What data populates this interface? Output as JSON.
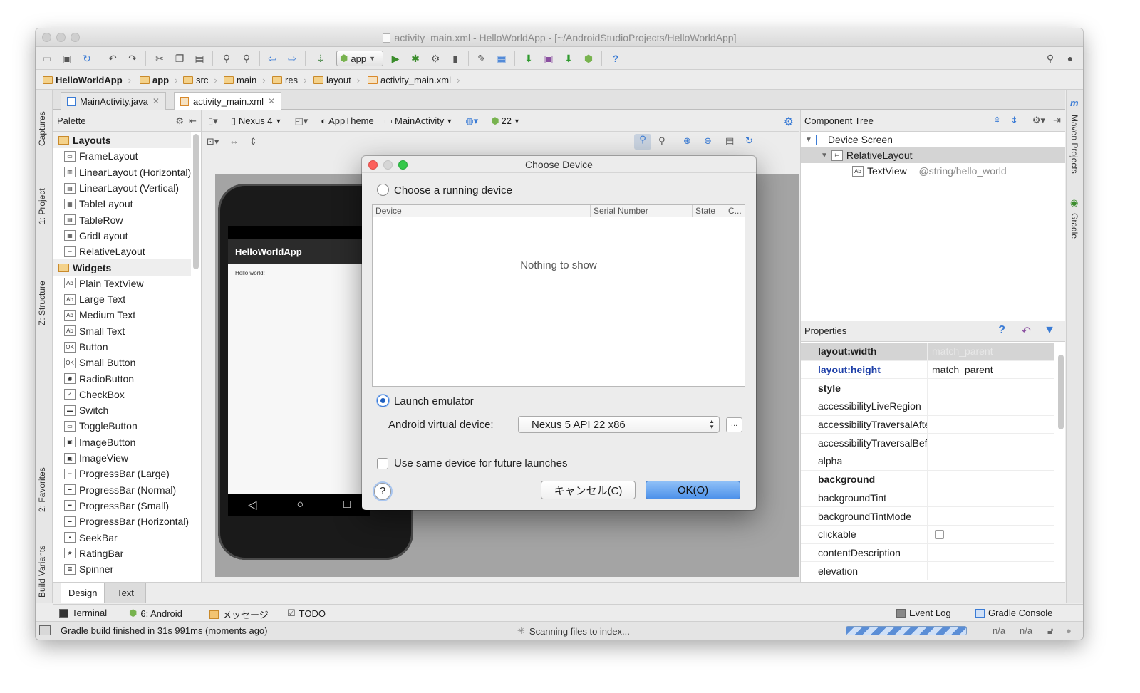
{
  "window": {
    "title": "activity_main.xml - HelloWorldApp - [~/AndroidStudioProjects/HelloWorldApp]"
  },
  "toolbar": {
    "run_config": "app"
  },
  "breadcrumb": [
    "HelloWorldApp",
    "app",
    "src",
    "main",
    "res",
    "layout",
    "activity_main.xml"
  ],
  "editor_tabs": [
    {
      "label": "MainActivity.java",
      "active": false
    },
    {
      "label": "activity_main.xml",
      "active": true
    }
  ],
  "left_tool_tabs": [
    "Captures",
    "1: Project",
    "Z: Structure",
    "2: Favorites",
    "Build Variants"
  ],
  "right_tool_tabs": [
    "Maven Projects",
    "Gradle"
  ],
  "palette": {
    "title": "Palette",
    "items": [
      {
        "label": "Layouts",
        "group": true
      },
      {
        "label": "FrameLayout"
      },
      {
        "label": "LinearLayout (Horizontal)"
      },
      {
        "label": "LinearLayout (Vertical)"
      },
      {
        "label": "TableLayout"
      },
      {
        "label": "TableRow"
      },
      {
        "label": "GridLayout"
      },
      {
        "label": "RelativeLayout"
      },
      {
        "label": "Widgets",
        "group": true
      },
      {
        "label": "Plain TextView"
      },
      {
        "label": "Large Text"
      },
      {
        "label": "Medium Text"
      },
      {
        "label": "Small Text"
      },
      {
        "label": "Button"
      },
      {
        "label": "Small Button"
      },
      {
        "label": "RadioButton"
      },
      {
        "label": "CheckBox"
      },
      {
        "label": "Switch"
      },
      {
        "label": "ToggleButton"
      },
      {
        "label": "ImageButton"
      },
      {
        "label": "ImageView"
      },
      {
        "label": "ProgressBar (Large)"
      },
      {
        "label": "ProgressBar (Normal)"
      },
      {
        "label": "ProgressBar (Small)"
      },
      {
        "label": "ProgressBar (Horizontal)"
      },
      {
        "label": "SeekBar"
      },
      {
        "label": "RatingBar"
      },
      {
        "label": "Spinner"
      }
    ]
  },
  "design_toolbar": {
    "device": "Nexus 4",
    "theme": "AppTheme",
    "activity": "MainActivity",
    "api": "22"
  },
  "preview": {
    "app_title": "HelloWorldApp",
    "body_text": "Hello world!"
  },
  "component_tree": {
    "title": "Component Tree",
    "rows": [
      {
        "label": "Device Screen",
        "sub": ""
      },
      {
        "label": "RelativeLayout",
        "sub": ""
      },
      {
        "label": "TextView",
        "sub": "– @string/hello_world"
      }
    ]
  },
  "properties": {
    "title": "Properties",
    "rows": [
      {
        "name": "layout:width",
        "value": "match_parent"
      },
      {
        "name": "layout:height",
        "value": "match_parent"
      },
      {
        "name": "style",
        "value": ""
      },
      {
        "name": "accessibilityLiveRegion",
        "value": ""
      },
      {
        "name": "accessibilityTraversalAfter",
        "value": ""
      },
      {
        "name": "accessibilityTraversalBefore",
        "value": ""
      },
      {
        "name": "alpha",
        "value": ""
      },
      {
        "name": "background",
        "value": ""
      },
      {
        "name": "backgroundTint",
        "value": ""
      },
      {
        "name": "backgroundTintMode",
        "value": ""
      },
      {
        "name": "clickable",
        "value": ""
      },
      {
        "name": "contentDescription",
        "value": ""
      },
      {
        "name": "elevation",
        "value": ""
      }
    ]
  },
  "bottom_tabs": {
    "design": "Design",
    "text": "Text"
  },
  "tool_windows": {
    "terminal": "Terminal",
    "android": "6: Android",
    "messages": "メッセージ",
    "todo": "TODO",
    "event_log": "Event Log",
    "gradle_console": "Gradle Console"
  },
  "status": {
    "message": "Gradle build finished in 31s 991ms (moments ago)",
    "indexing": "Scanning files to index...",
    "pos1": "n/a",
    "pos2": "n/a"
  },
  "dialog": {
    "title": "Choose Device",
    "running_label": "Choose a running device",
    "columns": [
      "Device",
      "Serial Number",
      "State",
      "C..."
    ],
    "empty_text": "Nothing to show",
    "launch_label": "Launch emulator",
    "avd_label": "Android virtual device:",
    "avd_value": "Nexus 5 API 22 x86",
    "more_button": "...",
    "same_device_label": "Use same device for future launches",
    "cancel_label": "キャンセル(C)",
    "ok_label": "OK(O)",
    "help_label": "?"
  }
}
